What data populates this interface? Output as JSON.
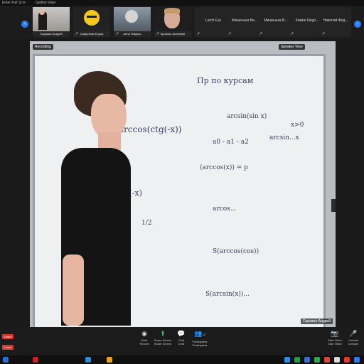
{
  "top_bar": {
    "gallery_view": "Gallery View",
    "exit_fullscreen": "Enter Full Scre"
  },
  "filmstrip": {
    "participants": [
      {
        "name": "Саражко Андрей",
        "kind": "video"
      },
      {
        "name": "Сафронов Федор",
        "kind": "avatar"
      },
      {
        "name": "Анна Гейдько",
        "kind": "video"
      },
      {
        "name": "Кроволь Асеевнов",
        "kind": "video"
      }
    ],
    "name_tiles": [
      "Lurch Fyo",
      "Машенька Ва...",
      "Мишенька В...",
      "Кемие Шкур...",
      "Николай Фед..."
    ]
  },
  "main_video": {
    "speaker_badge": "Recording",
    "view_button": "Speaker View",
    "participant_name": "Саражко Андрей",
    "whiteboard_title": "Пр по курсам",
    "writing": [
      "arccos(ctg(-x))",
      "arcsin(sin x)",
      "arcsin...x",
      "arccos(-x)",
      "(arccos(x)) = p",
      "a0 - a1 - a2",
      "arcos...",
      "S(arccos(cos))",
      "1/2",
      "S(arcsin(x))...",
      "x>0"
    ]
  },
  "toolbar": {
    "leave": "Leave",
    "buttons": [
      {
        "icon": "mic-icon",
        "label": "Mute",
        "sub": "Record"
      },
      {
        "icon": "share-icon",
        "label": "Share Screen",
        "sub": "Share Screen"
      },
      {
        "icon": "chat-icon",
        "label": "Chat",
        "sub": "Chat"
      },
      {
        "icon": "participants-icon",
        "label": "Participants",
        "sub": "Participants",
        "count": "12"
      },
      {
        "icon": "video-icon",
        "label": "Start Video",
        "sub": "Start Video"
      },
      {
        "icon": "mic-icon",
        "label": "Unmute",
        "sub": "Unmute"
      }
    ]
  },
  "colors": {
    "accent": "#2d7cf6",
    "leave": "#d9362b"
  }
}
